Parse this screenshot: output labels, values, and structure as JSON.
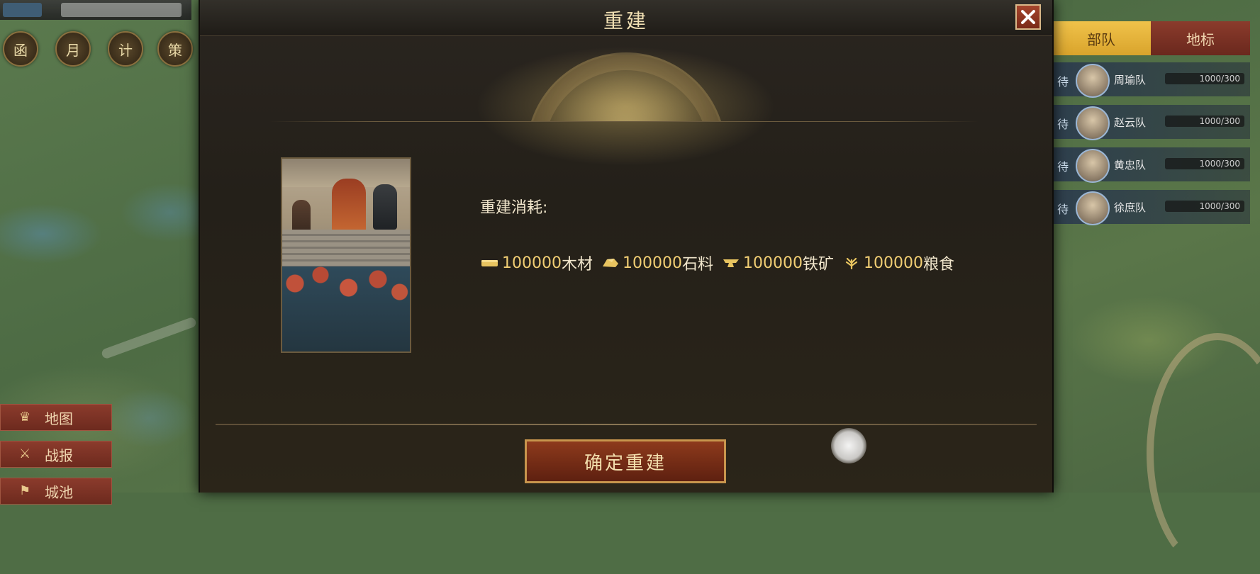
{
  "dialog": {
    "title": "重建",
    "cost_label": "重建消耗:",
    "costs": [
      {
        "icon": "wood-icon",
        "amount": "100000",
        "unit": "木材"
      },
      {
        "icon": "stone-icon",
        "amount": "100000",
        "unit": "石料"
      },
      {
        "icon": "iron-icon",
        "amount": "100000",
        "unit": "铁矿"
      },
      {
        "icon": "grain-icon",
        "amount": "100000",
        "unit": "粮食"
      }
    ],
    "confirm_label": "确定重建",
    "close_icon": "close-icon"
  },
  "background": {
    "left_round_buttons": [
      "函",
      "月",
      "计",
      "策"
    ],
    "left_side_buttons": [
      "地图",
      "战报",
      "城池"
    ],
    "right_tabs": [
      "部队",
      "地标"
    ],
    "troops": [
      {
        "name": "周瑜队",
        "value": "1000/300"
      },
      {
        "name": "赵云队",
        "value": "1000/300"
      },
      {
        "name": "黄忠队",
        "value": "1000/300"
      },
      {
        "name": "徐庶队",
        "value": "1000/300"
      }
    ]
  },
  "colors": {
    "accent_gold": "#f2cf74",
    "button_red": "#8d3a1c",
    "active_tab": "#f0c24a"
  }
}
